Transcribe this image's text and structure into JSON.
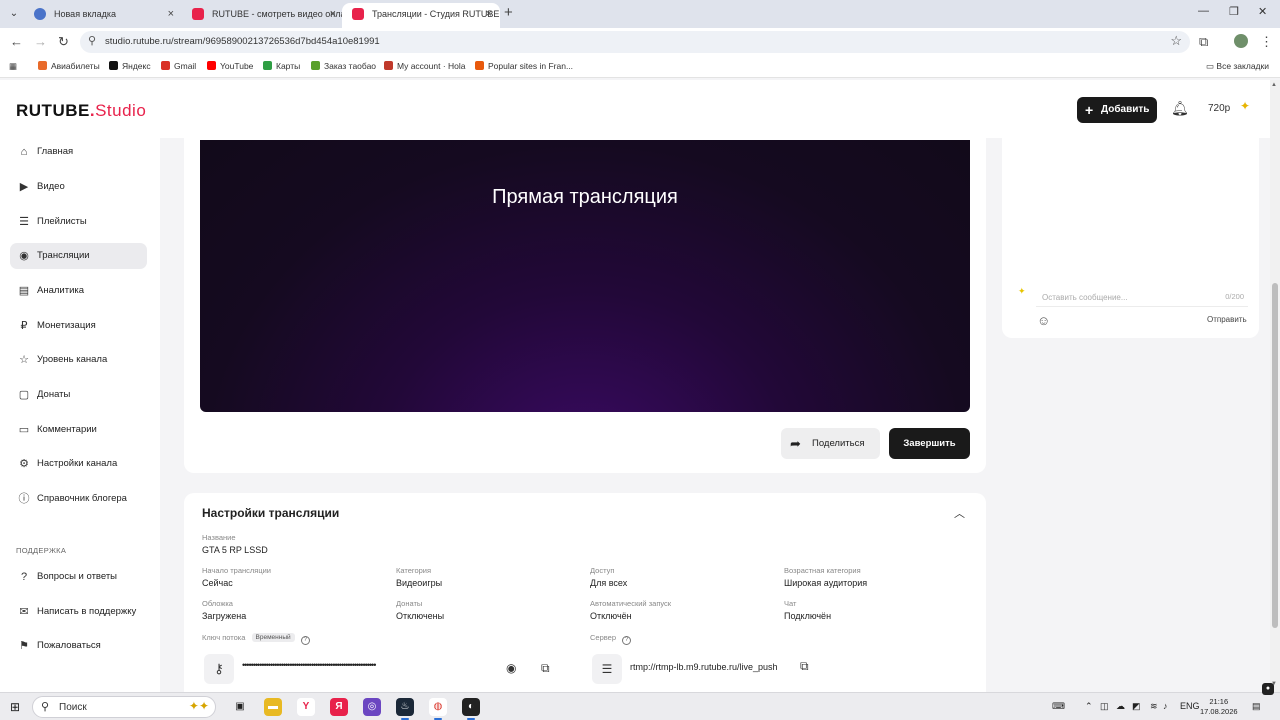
{
  "browser": {
    "tabs": [
      {
        "title": "Новая вкладка",
        "color": "#4a73c9",
        "active": false
      },
      {
        "title": "RUTUBE - смотреть видео онлайн",
        "color": "#e8224b",
        "active": false
      },
      {
        "title": "Трансляции - Студия RUTUBE",
        "color": "#e8224b",
        "active": true
      }
    ],
    "new_tab": "+",
    "url": "studio.rutube.ru/stream/96958900213726536d7bd454a10e81991",
    "bookmarks": [
      {
        "label": "Авиабилеты",
        "color": "#e86a2a"
      },
      {
        "label": "Яндекс",
        "color": "#111111"
      },
      {
        "label": "Gmail",
        "color": "#d93025"
      },
      {
        "label": "YouTube",
        "color": "#ff0000"
      },
      {
        "label": "Карты",
        "color": "#2f9e44"
      },
      {
        "label": "Заказ таобао",
        "color": "#5aa02c"
      },
      {
        "label": "My account · Hola",
        "color": "#c0392b"
      },
      {
        "label": "Popular sites in Fran...",
        "color": "#e8590c"
      }
    ],
    "all_bookmarks": "Все закладки"
  },
  "header": {
    "logo_main": "RUTUBE",
    "logo_dot": ".",
    "logo_sub": "Studio",
    "add_button": "Добавить",
    "quality": "720p"
  },
  "sidebar": {
    "items": [
      {
        "label": "Главная",
        "icon": "home-icon",
        "glyph": "⌂"
      },
      {
        "label": "Видео",
        "icon": "video-icon",
        "glyph": "▶"
      },
      {
        "label": "Плейлисты",
        "icon": "playlist-icon",
        "glyph": "☰"
      },
      {
        "label": "Трансляции",
        "icon": "broadcast-icon",
        "glyph": "◉"
      },
      {
        "label": "Аналитика",
        "icon": "analytics-icon",
        "glyph": "▤"
      },
      {
        "label": "Монетизация",
        "icon": "monetization-icon",
        "glyph": "₽"
      },
      {
        "label": "Уровень канала",
        "icon": "star-icon",
        "glyph": "☆"
      },
      {
        "label": "Донаты",
        "icon": "donate-icon",
        "glyph": "▢"
      },
      {
        "label": "Комментарии",
        "icon": "comments-icon",
        "glyph": "▭"
      },
      {
        "label": "Настройки канала",
        "icon": "gear-icon",
        "glyph": "⚙"
      },
      {
        "label": "Справочник блогера",
        "icon": "help-circle-icon",
        "glyph": "ⓘ"
      }
    ],
    "active_index": 3,
    "support_heading": "ПОДДЕРЖКА",
    "support_items": [
      {
        "label": "Вопросы и ответы",
        "icon": "question-icon",
        "glyph": "?"
      },
      {
        "label": "Написать в поддержку",
        "icon": "mail-icon",
        "glyph": "✉"
      },
      {
        "label": "Пожаловаться",
        "icon": "flag-icon",
        "glyph": "⚑"
      }
    ]
  },
  "player": {
    "title": "Прямая трансляция",
    "share_button": "Поделиться",
    "end_button": "Завершить"
  },
  "settings": {
    "title": "Настройки трансляции",
    "name_label": "Название",
    "name_value": "GTA 5 RP LSSD",
    "fields": [
      {
        "label": "Начало трансляции",
        "value": "Сейчас"
      },
      {
        "label": "Категория",
        "value": "Видеоигры"
      },
      {
        "label": "Доступ",
        "value": "Для всех"
      },
      {
        "label": "Возрастная категория",
        "value": "Широкая аудитория"
      },
      {
        "label": "Обложка",
        "value": "Загружена"
      },
      {
        "label": "Донаты",
        "value": "Отключены"
      },
      {
        "label": "Автоматический запуск",
        "value": "Отключён"
      },
      {
        "label": "Чат",
        "value": "Подключён"
      }
    ],
    "stream_key_label": "Ключ потока",
    "stream_key_badge": "Временный",
    "stream_key_masked": "••••••••••••••••••••••••••••••••••••••••••••••••••••••••••••••",
    "server_label": "Сервер",
    "server_url": "rtmp://rtmp-lb.m9.rutube.ru/live_push"
  },
  "chat": {
    "placeholder": "Оставить сообщение...",
    "counter": "0/200",
    "send": "Отправить"
  },
  "taskbar": {
    "search": "Поиск",
    "lang": "ENG",
    "time": "21:16",
    "date": "17.08.2026"
  }
}
